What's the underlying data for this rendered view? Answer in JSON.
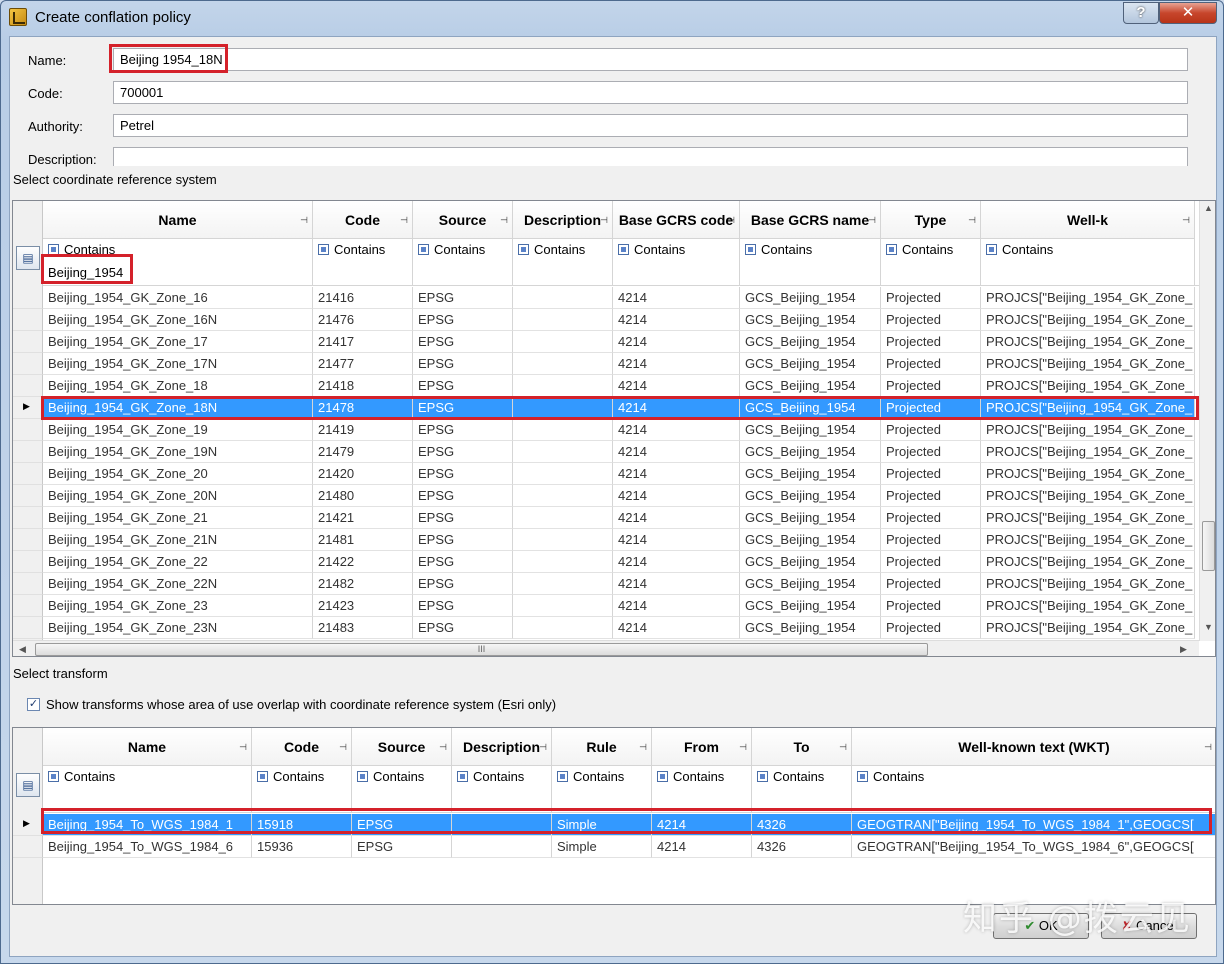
{
  "window": {
    "title": "Create conflation policy",
    "help_label": "?",
    "close_label": "✕"
  },
  "form": {
    "name_label": "Name:",
    "name_value": "Beijing 1954_18N",
    "code_label": "Code:",
    "code_value": "700001",
    "authority_label": "Authority:",
    "authority_value": "Petrel",
    "description_label": "Description:",
    "description_value": ""
  },
  "crs_section": {
    "label": "Select coordinate reference system",
    "filter_toggle_icon": "filter-icon",
    "columns": [
      {
        "label": "Name",
        "filter": "Contains"
      },
      {
        "label": "Code",
        "filter": "Contains"
      },
      {
        "label": "Source",
        "filter": "Contains"
      },
      {
        "label": "Description",
        "filter": "Contains"
      },
      {
        "label": "Base GCRS code",
        "filter": "Contains"
      },
      {
        "label": "Base GCRS name",
        "filter": "Contains"
      },
      {
        "label": "Type",
        "filter": "Contains"
      },
      {
        "label": "Well-k",
        "filter": "Contains"
      }
    ],
    "name_filter_value": "Beijing_1954",
    "rows": [
      [
        "Beijing_1954_GK_Zone_16",
        "21416",
        "EPSG",
        "",
        "4214",
        "GCS_Beijing_1954",
        "Projected",
        "PROJCS[\"Beijing_1954_GK_Zone_"
      ],
      [
        "Beijing_1954_GK_Zone_16N",
        "21476",
        "EPSG",
        "",
        "4214",
        "GCS_Beijing_1954",
        "Projected",
        "PROJCS[\"Beijing_1954_GK_Zone_"
      ],
      [
        "Beijing_1954_GK_Zone_17",
        "21417",
        "EPSG",
        "",
        "4214",
        "GCS_Beijing_1954",
        "Projected",
        "PROJCS[\"Beijing_1954_GK_Zone_"
      ],
      [
        "Beijing_1954_GK_Zone_17N",
        "21477",
        "EPSG",
        "",
        "4214",
        "GCS_Beijing_1954",
        "Projected",
        "PROJCS[\"Beijing_1954_GK_Zone_"
      ],
      [
        "Beijing_1954_GK_Zone_18",
        "21418",
        "EPSG",
        "",
        "4214",
        "GCS_Beijing_1954",
        "Projected",
        "PROJCS[\"Beijing_1954_GK_Zone_"
      ],
      [
        "Beijing_1954_GK_Zone_18N",
        "21478",
        "EPSG",
        "",
        "4214",
        "GCS_Beijing_1954",
        "Projected",
        "PROJCS[\"Beijing_1954_GK_Zone_"
      ],
      [
        "Beijing_1954_GK_Zone_19",
        "21419",
        "EPSG",
        "",
        "4214",
        "GCS_Beijing_1954",
        "Projected",
        "PROJCS[\"Beijing_1954_GK_Zone_"
      ],
      [
        "Beijing_1954_GK_Zone_19N",
        "21479",
        "EPSG",
        "",
        "4214",
        "GCS_Beijing_1954",
        "Projected",
        "PROJCS[\"Beijing_1954_GK_Zone_"
      ],
      [
        "Beijing_1954_GK_Zone_20",
        "21420",
        "EPSG",
        "",
        "4214",
        "GCS_Beijing_1954",
        "Projected",
        "PROJCS[\"Beijing_1954_GK_Zone_"
      ],
      [
        "Beijing_1954_GK_Zone_20N",
        "21480",
        "EPSG",
        "",
        "4214",
        "GCS_Beijing_1954",
        "Projected",
        "PROJCS[\"Beijing_1954_GK_Zone_"
      ],
      [
        "Beijing_1954_GK_Zone_21",
        "21421",
        "EPSG",
        "",
        "4214",
        "GCS_Beijing_1954",
        "Projected",
        "PROJCS[\"Beijing_1954_GK_Zone_"
      ],
      [
        "Beijing_1954_GK_Zone_21N",
        "21481",
        "EPSG",
        "",
        "4214",
        "GCS_Beijing_1954",
        "Projected",
        "PROJCS[\"Beijing_1954_GK_Zone_"
      ],
      [
        "Beijing_1954_GK_Zone_22",
        "21422",
        "EPSG",
        "",
        "4214",
        "GCS_Beijing_1954",
        "Projected",
        "PROJCS[\"Beijing_1954_GK_Zone_"
      ],
      [
        "Beijing_1954_GK_Zone_22N",
        "21482",
        "EPSG",
        "",
        "4214",
        "GCS_Beijing_1954",
        "Projected",
        "PROJCS[\"Beijing_1954_GK_Zone_"
      ],
      [
        "Beijing_1954_GK_Zone_23",
        "21423",
        "EPSG",
        "",
        "4214",
        "GCS_Beijing_1954",
        "Projected",
        "PROJCS[\"Beijing_1954_GK_Zone_"
      ],
      [
        "Beijing_1954_GK_Zone_23N",
        "21483",
        "EPSG",
        "",
        "4214",
        "GCS_Beijing_1954",
        "Projected",
        "PROJCS[\"Beijing_1954_GK_Zone_"
      ]
    ],
    "selected_row": 5,
    "hscroll_grip": "III"
  },
  "transform_section": {
    "label": "Select transform",
    "overlap_checkbox_checked": true,
    "overlap_checkbox_mark": "✓",
    "overlap_checkbox_label": "Show transforms whose area of use overlap with coordinate reference system (Esri only)",
    "columns": [
      {
        "label": "Name",
        "filter": "Contains"
      },
      {
        "label": "Code",
        "filter": "Contains"
      },
      {
        "label": "Source",
        "filter": "Contains"
      },
      {
        "label": "Description",
        "filter": "Contains"
      },
      {
        "label": "Rule",
        "filter": "Contains"
      },
      {
        "label": "From",
        "filter": "Contains"
      },
      {
        "label": "To",
        "filter": "Contains"
      },
      {
        "label": "Well-known text (WKT)",
        "filter": "Contains"
      }
    ],
    "rows": [
      [
        "Beijing_1954_To_WGS_1984_1",
        "15918",
        "EPSG",
        "",
        "Simple",
        "4214",
        "4326",
        "GEOGTRAN[\"Beijing_1954_To_WGS_1984_1\",GEOGCS["
      ],
      [
        "Beijing_1954_To_WGS_1984_6",
        "15936",
        "EPSG",
        "",
        "Simple",
        "4214",
        "4326",
        "GEOGTRAN[\"Beijing_1954_To_WGS_1984_6\",GEOGCS["
      ]
    ],
    "selected_row": 0
  },
  "buttons": {
    "ok_label": "OK",
    "cancel_label": "Cancel"
  },
  "watermark": "知乎 @拨云见",
  "colors": {
    "selection": "#3399ff",
    "highlight_border": "#d4212a",
    "close_button": "#c7462c"
  }
}
